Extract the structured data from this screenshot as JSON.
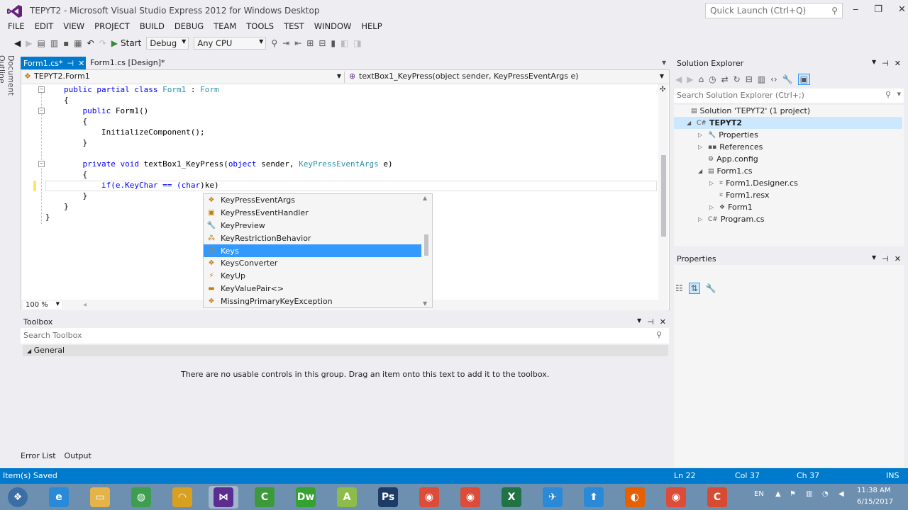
{
  "window": {
    "title": "TEPYT2 - Microsoft Visual Studio Express 2012 for Windows Desktop",
    "quick_launch_placeholder": "Quick Launch (Ctrl+Q)",
    "minimize": "‒",
    "restore": "❐",
    "close": "✕"
  },
  "menu": [
    "FILE",
    "EDIT",
    "VIEW",
    "PROJECT",
    "BUILD",
    "DEBUG",
    "TEAM",
    "TOOLS",
    "TEST",
    "WINDOW",
    "HELP"
  ],
  "toolbar": {
    "start_label": "Start",
    "config": "Debug",
    "platform": "Any CPU"
  },
  "side_tab": "Document Outline",
  "editor": {
    "tabs": [
      {
        "label": "Form1.cs*",
        "pin": "⊣",
        "close": "✕"
      },
      {
        "label": "Form1.cs [Design]*"
      }
    ],
    "nav_left": "TEPYT2.Form1",
    "nav_right": "textBox1_KeyPress(object sender, KeyPressEventArgs e)",
    "zoom": "100 %",
    "code_lines": [
      [
        "",
        "public partial class ",
        "Form1",
        " : ",
        "Form",
        ""
      ],
      [
        "",
        "{",
        "",
        "",
        "",
        ""
      ],
      [
        "",
        "    public ",
        "Form1",
        "()",
        "",
        ""
      ],
      [
        "",
        "    {",
        "",
        "",
        "",
        ""
      ],
      [
        "",
        "        InitializeComponent();",
        "",
        "",
        "",
        ""
      ],
      [
        "",
        "    }",
        "",
        "",
        "",
        ""
      ],
      [
        "",
        "",
        "",
        "",
        "",
        ""
      ],
      [
        "",
        "    private void ",
        "textBox1_KeyPress(",
        "object",
        " sender, ",
        "KeyPressEventArgs"
      ],
      [
        "",
        "    {",
        "",
        "",
        "",
        ""
      ],
      [
        "",
        "        if(e.KeyChar == (",
        "char",
        ")ke)",
        "",
        ""
      ],
      [
        "",
        "    }",
        "",
        "",
        "",
        ""
      ],
      [
        "",
        "}",
        "",
        "",
        "",
        ""
      ],
      [
        "",
        "}",
        "",
        "",
        "",
        ""
      ]
    ],
    "line8_tail": " e)"
  },
  "intellisense": {
    "items": [
      {
        "label": "KeyPressEventArgs",
        "icon": "class-icon",
        "glyph": "❖"
      },
      {
        "label": "KeyPressEventHandler",
        "icon": "delegate-icon",
        "glyph": "▣"
      },
      {
        "label": "KeyPreview",
        "icon": "property-icon",
        "glyph": "🔧"
      },
      {
        "label": "KeyRestrictionBehavior",
        "icon": "enum-icon",
        "glyph": "⁂"
      },
      {
        "label": "Keys",
        "icon": "enum-icon",
        "glyph": "⁂"
      },
      {
        "label": "KeysConverter",
        "icon": "class-icon",
        "glyph": "❖"
      },
      {
        "label": "KeyUp",
        "icon": "event-icon",
        "glyph": "⚡"
      },
      {
        "label": "KeyValuePair<>",
        "icon": "struct-icon",
        "glyph": "▬"
      },
      {
        "label": "MissingPrimaryKeyException",
        "icon": "class-icon",
        "glyph": "❖"
      }
    ],
    "selected_index": 4
  },
  "toolbox": {
    "title": "Toolbox",
    "search_placeholder": "Search Toolbox",
    "group": "General",
    "empty_text": "There are no usable controls in this group. Drag an item onto this text to add it to the toolbox."
  },
  "bottom_tabs": [
    "Error List",
    "Output"
  ],
  "status": {
    "message": "Item(s) Saved",
    "ln": "Ln 22",
    "col": "Col 37",
    "ch": "Ch 37",
    "mode": "INS"
  },
  "solution_explorer": {
    "title": "Solution Explorer",
    "search_placeholder": "Search Solution Explorer (Ctrl+;)",
    "items": [
      {
        "label": "Solution 'TEPYT2' (1 project)",
        "icon": "solution-icon",
        "glyph": "▤",
        "arrow": ""
      },
      {
        "label": "TEPYT2",
        "icon": "csproj-icon",
        "glyph": "C#",
        "arrow": "◢"
      },
      {
        "label": "Properties",
        "icon": "wrench-icon",
        "glyph": "🔧",
        "arrow": "▷"
      },
      {
        "label": "References",
        "icon": "references-icon",
        "glyph": "▪▪",
        "arrow": "▷"
      },
      {
        "label": "App.config",
        "icon": "config-icon",
        "glyph": "⚙",
        "arrow": ""
      },
      {
        "label": "Form1.cs",
        "icon": "form-icon",
        "glyph": "▤",
        "arrow": "◢"
      },
      {
        "label": "Form1.Designer.cs",
        "icon": "cs-file-icon",
        "glyph": "⌗",
        "arrow": "▷"
      },
      {
        "label": "Form1.resx",
        "icon": "resx-icon",
        "glyph": "⌗",
        "arrow": ""
      },
      {
        "label": "Form1",
        "icon": "class-icon",
        "glyph": "❖",
        "arrow": "▷"
      },
      {
        "label": "Program.cs",
        "icon": "cs-file-icon",
        "glyph": "C#",
        "arrow": "▷"
      }
    ]
  },
  "properties": {
    "title": "Properties"
  },
  "tray": {
    "lang": "EN",
    "time": "11:38 AM",
    "date": "6/15/2017"
  },
  "taskbar": [
    {
      "name": "start-button",
      "label": "❖",
      "color": "#3a6ea5"
    },
    {
      "name": "ie-taskbar-icon",
      "label": "e",
      "color": "#2a8ad8"
    },
    {
      "name": "explorer-taskbar-icon",
      "label": "▭",
      "color": "#e4b34a"
    },
    {
      "name": "globe-taskbar-icon",
      "label": "◍",
      "color": "#3d9e50"
    },
    {
      "name": "headphones-taskbar-icon",
      "label": "◠",
      "color": "#d8a020"
    },
    {
      "name": "visual-studio-taskbar-icon",
      "label": "⋈",
      "color": "#5c2d91"
    },
    {
      "name": "camtasia-taskbar-icon",
      "label": "C",
      "color": "#3c9a3c"
    },
    {
      "name": "dreamweaver-taskbar-icon",
      "label": "Dw",
      "color": "#35a130"
    },
    {
      "name": "android-taskbar-icon",
      "label": "A",
      "color": "#8ebc4a"
    },
    {
      "name": "photoshop-taskbar-icon",
      "label": "Ps",
      "color": "#1c3b66"
    },
    {
      "name": "chrome-taskbar-icon",
      "label": "◉",
      "color": "#dd4b39"
    },
    {
      "name": "chrome2-taskbar-icon",
      "label": "◉",
      "color": "#dd4b39"
    },
    {
      "name": "excel-taskbar-icon",
      "label": "X",
      "color": "#217346"
    },
    {
      "name": "bird-taskbar-icon",
      "label": "✈",
      "color": "#2a8ad8"
    },
    {
      "name": "upload-taskbar-icon",
      "label": "⬆",
      "color": "#2a8ad8"
    },
    {
      "name": "firefox-taskbar-icon",
      "label": "◐",
      "color": "#e66000"
    },
    {
      "name": "chrome3-taskbar-icon",
      "label": "◉",
      "color": "#dd4b39"
    },
    {
      "name": "camtasia2-taskbar-icon",
      "label": "C",
      "color": "#d64b32"
    }
  ]
}
